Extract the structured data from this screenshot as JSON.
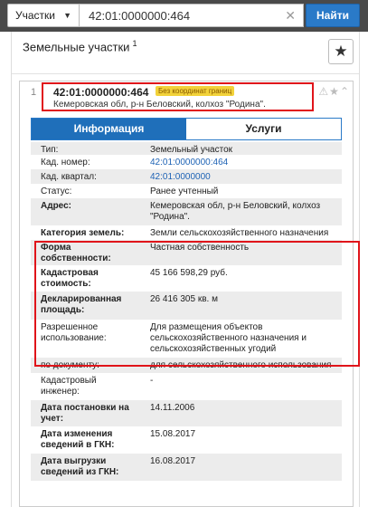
{
  "search": {
    "type_label": "Участки",
    "value": "42:01:0000000:464",
    "button_label": "Найти"
  },
  "panel": {
    "title": "Земельные участки",
    "count": "1"
  },
  "card": {
    "index": "1",
    "cadastral_number": "42:01:0000000:464",
    "badge": "Без координат границ",
    "address_short": "Кемеровская обл, р-н Беловский, колхоз \"Родина\"."
  },
  "tabs": [
    {
      "label": "Информация"
    },
    {
      "label": "Услуги"
    }
  ],
  "properties": [
    {
      "label": "Тип:",
      "value": "Земельный участок"
    },
    {
      "label": "Кад. номер:",
      "value": "42:01:0000000:464"
    },
    {
      "label": "Кад. квартал:",
      "value": "42:01:0000000"
    },
    {
      "label": "Статус:",
      "value": "Ранее учтенный"
    },
    {
      "label": "Адрес:",
      "value": "Кемеровская обл, р-н Беловский, колхоз \"Родина\"."
    },
    {
      "label": "Категория земель:",
      "value": "Земли сельскохозяйственного назначения"
    },
    {
      "label": "Форма собственности:",
      "value": "Частная собственность"
    },
    {
      "label": "Кадастровая стоимость:",
      "value": "45 166 598,29 руб."
    },
    {
      "label": "Декларированная площадь:",
      "value": "26 416 305 кв. м"
    },
    {
      "label": "Разрешенное использование:",
      "value": "Для размещения объектов сельскохозяйственного назначения и сельскохозяйственных угодий"
    },
    {
      "label": "по документу:",
      "value": "для сельскохозяйственного использования"
    },
    {
      "label": "Кадастровый инженер:",
      "value": "-"
    },
    {
      "label": "Дата постановки на учет:",
      "value": "14.11.2006"
    },
    {
      "label": "Дата изменения сведений в ГКН:",
      "value": "15.08.2017"
    },
    {
      "label": "Дата выгрузки сведений из ГКН:",
      "value": "16.08.2017"
    }
  ]
}
